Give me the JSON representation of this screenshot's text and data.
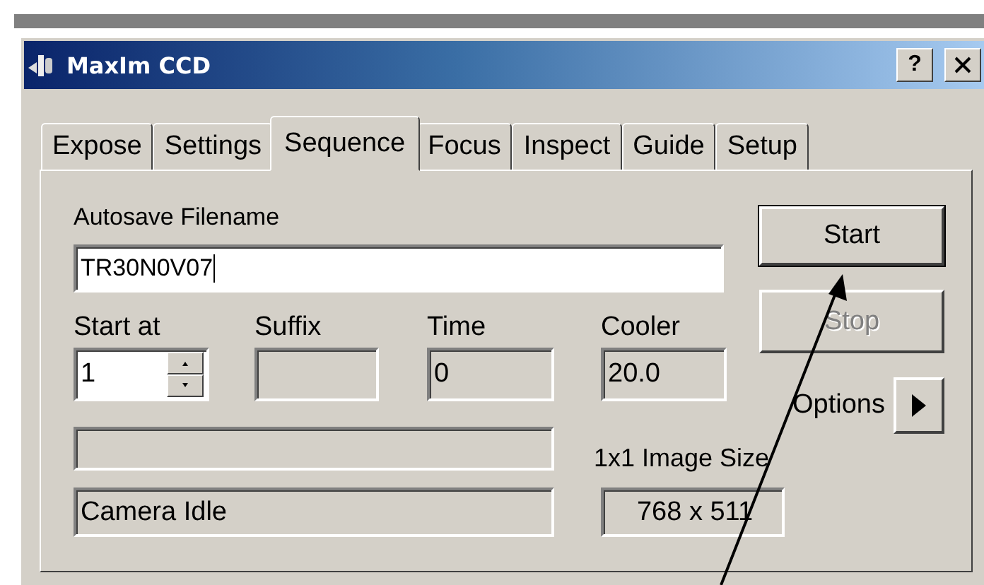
{
  "window": {
    "title": "MaxIm CCD",
    "help_button": "?"
  },
  "tabs": [
    {
      "label": "Expose",
      "selected": false
    },
    {
      "label": "Settings",
      "selected": false
    },
    {
      "label": "Sequence",
      "selected": true
    },
    {
      "label": "Focus",
      "selected": false
    },
    {
      "label": "Inspect",
      "selected": false
    },
    {
      "label": "Guide",
      "selected": false
    },
    {
      "label": "Setup",
      "selected": false
    }
  ],
  "autosave": {
    "label": "Autosave Filename",
    "value": "TR30N0V07"
  },
  "fields": [
    {
      "label": "Start at",
      "value": "1",
      "kind": "spinner"
    },
    {
      "label": "Suffix",
      "kind": "readonly"
    },
    {
      "label": "Time",
      "value": "0",
      "kind": "readonly"
    },
    {
      "label": "Cooler",
      "value": "20.0",
      "kind": "readonly"
    }
  ],
  "status": {
    "value": "Camera Idle"
  },
  "image_size": {
    "label": "1x1 Image Size",
    "value": "768 x 511"
  },
  "buttons": [
    {
      "label": "Start",
      "disabled": false,
      "default": true
    },
    {
      "label": "Stop",
      "disabled": true,
      "default": false
    }
  ],
  "options": {
    "label": "Options"
  }
}
